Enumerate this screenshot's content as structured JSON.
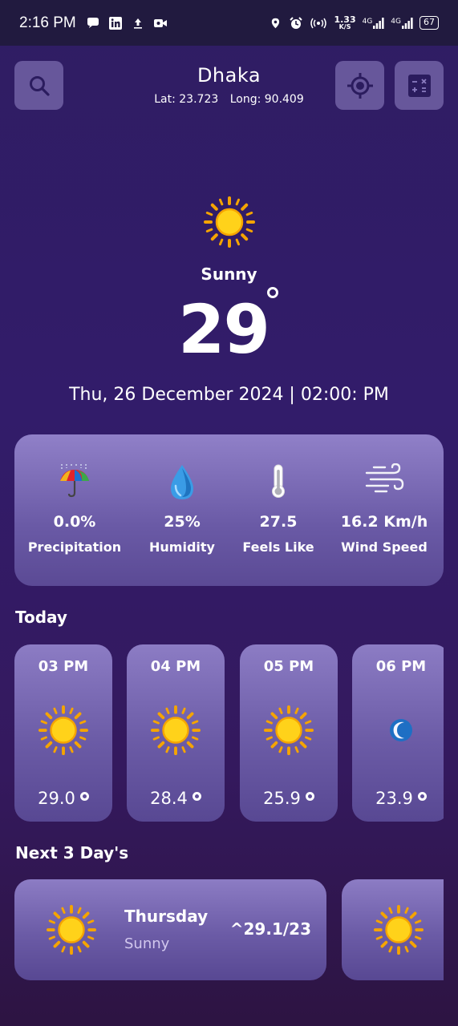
{
  "status_bar": {
    "time": "2:16 PM",
    "net_speed_value": "1.33",
    "net_speed_unit": "K/S",
    "network_1": "4G",
    "network_2": "4G",
    "battery": "67"
  },
  "header": {
    "city": "Dhaka",
    "lat_label": "Lat: 23.723",
    "long_label": "Long: 90.409"
  },
  "current": {
    "condition": "Sunny",
    "temperature": "29",
    "datetime": "Thu, 26 December 2024 | 02:00: PM"
  },
  "stats": [
    {
      "value": "0.0%",
      "label": "Precipitation",
      "icon": "umbrella-rain-icon"
    },
    {
      "value": "25%",
      "label": "Humidity",
      "icon": "water-drop-icon"
    },
    {
      "value": "27.5",
      "label": "Feels Like",
      "icon": "thermometer-icon"
    },
    {
      "value": "16.2 Km/h",
      "label": "Wind Speed",
      "icon": "wind-icon"
    }
  ],
  "today": {
    "title": "Today",
    "hours": [
      {
        "time": "03 PM",
        "temp": "29.0",
        "icon": "sun-icon"
      },
      {
        "time": "04 PM",
        "temp": "28.4",
        "icon": "sun-icon"
      },
      {
        "time": "05 PM",
        "temp": "25.9",
        "icon": "sun-icon"
      },
      {
        "time": "06 PM",
        "temp": "23.9",
        "icon": "moon-icon"
      }
    ]
  },
  "forecast": {
    "title": "Next 3 Day's",
    "days": [
      {
        "day": "Thursday",
        "condition": "Sunny",
        "range": "^29.1/23",
        "icon": "sun-icon"
      }
    ]
  },
  "colors": {
    "background": "#321c6a",
    "card": "#7a6ab5",
    "sun": "#f5b800",
    "text": "#ffffff"
  }
}
